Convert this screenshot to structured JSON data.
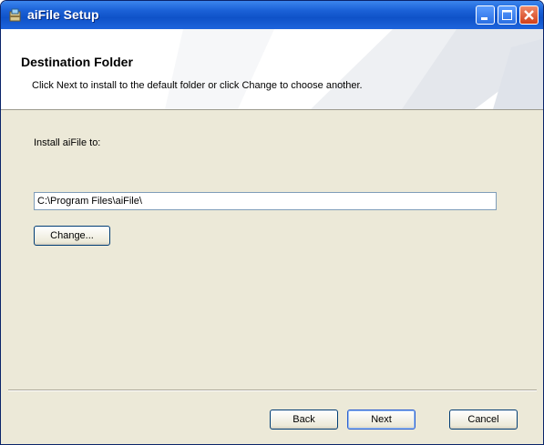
{
  "window": {
    "title": "aiFile Setup",
    "icon": "setup-package-icon",
    "controls": [
      "minimize-icon",
      "maximize-icon",
      "close-icon"
    ]
  },
  "header": {
    "title": "Destination Folder",
    "description": "Click Next to install to the default folder or click Change to choose another."
  },
  "body": {
    "install_label": "Install aiFile to:",
    "install_path": "C:\\Program Files\\aiFile\\",
    "change_label": "Change..."
  },
  "footer": {
    "back_label": "Back",
    "next_label": "Next",
    "cancel_label": "Cancel"
  },
  "colors": {
    "titlebar": "#0f52c8",
    "dialog_bg": "#ece9d8",
    "close_button": "#d0401a"
  }
}
